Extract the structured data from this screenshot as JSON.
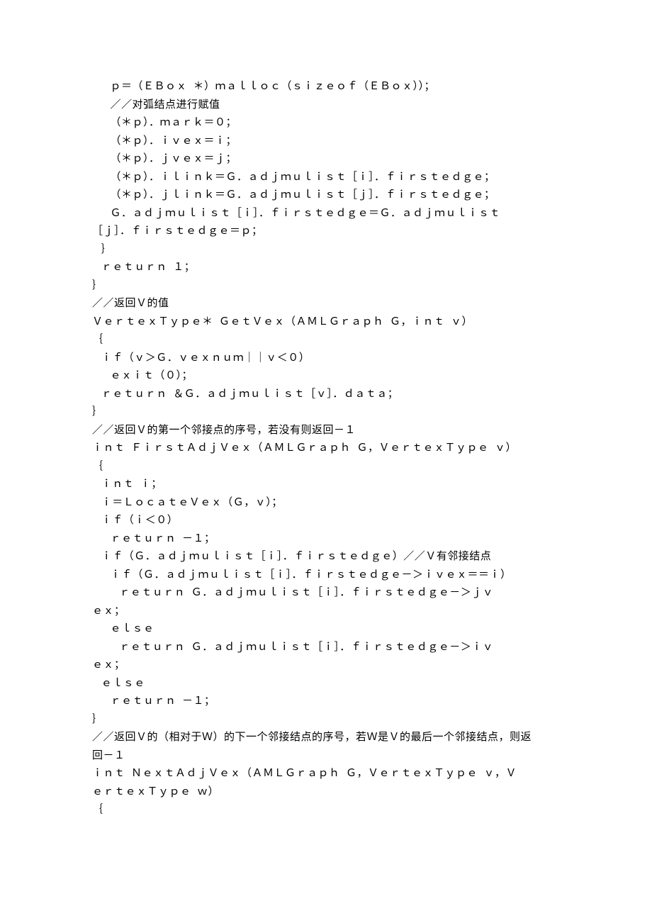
{
  "lines": [
    "      ｐ＝（ＥＢｏｘ  ＊）ｍａｌｌｏｃ（ｓｉｚｅｏｆ（ＥＢｏｘ））；",
    "      ／／对弧结点进行赋值",
    "      （＊ｐ）．ｍａｒｋ＝０；",
    "      （＊ｐ）．ｉｖｅｘ＝ｉ；",
    "      （＊ｐ）．ｊｖｅｘ＝ｊ；",
    "      （＊ｐ）．ｉｌｉｎｋ＝Ｇ．ａｄｊｍｕｌｉｓｔ［ｉ］．ｆｉｒｓｔｅｄｇｅ；",
    "      （＊ｐ）．ｊｌｉｎｋ＝Ｇ．ａｄｊｍｕｌｉｓｔ［ｊ］．ｆｉｒｓｔｅｄｇｅ；",
    "      Ｇ．ａｄｊｍｕｌｉｓｔ［ｉ］．ｆｉｒｓｔｅｄｇｅ＝Ｇ．ａｄｊｍｕｌｉｓｔ",
    "［ｊ］．ｆｉｒｓｔｅｄｇｅ＝ｐ；",
    "",
    "   ｝",
    "   ｒｅｔｕｒｎ  １；",
    "｝",
    "",
    "／／返回Ｖ的值",
    "ＶｅｒｔｅｘＴｙｐｅ＊  ＧｅｔＶｅｘ（ＡＭＬＧｒａｐｈ  Ｇ，ｉｎｔ  ｖ）",
    "｛",
    "   ｉｆ（ｖ＞Ｇ．ｖｅｘｎｕｍ｜｜ｖ＜０）",
    "      ｅｘｉｔ（０）；",
    "   ｒｅｔｕｒｎ  ＆Ｇ．ａｄｊｍｕｌｉｓｔ［ｖ］．ｄａｔａ；",
    "｝",
    "／／返回Ｖ的第一个邻接点的序号，若没有则返回－１",
    "ｉｎｔ  ＦｉｒｓｔＡｄｊＶｅｘ（ＡＭＬＧｒａｐｈ  Ｇ，ＶｅｒｔｅｘＴｙｐｅ  ｖ）",
    "｛",
    "",
    "   ｉｎｔ  ｉ；",
    "   ｉ＝ＬｏｃａｔｅＶｅｘ（Ｇ，ｖ）；",
    "   ｉｆ（ｉ＜０）",
    "      ｒｅｔｕｒｎ  －１；",
    "   ｉｆ（Ｇ．ａｄｊｍｕｌｉｓｔ［ｉ］．ｆｉｒｓｔｅｄｇｅ）／／Ｖ有邻接结点",
    "      ｉｆ（Ｇ．ａｄｊｍｕｌｉｓｔ［ｉ］．ｆｉｒｓｔｅｄｇｅ－＞ｉｖｅｘ＝＝ｉ）",
    "         ｒｅｔｕｒｎ  Ｇ．ａｄｊｍｕｌｉｓｔ［ｉ］．ｆｉｒｓｔｅｄｇｅ－＞ｊｖ",
    "ｅｘ；",
    "      ｅｌｓｅ",
    "         ｒｅｔｕｒｎ  Ｇ．ａｄｊｍｕｌｉｓｔ［ｉ］．ｆｉｒｓｔｅｄｇｅ－＞ｉｖ",
    "ｅｘ；",
    "   ｅｌｓｅ",
    "      ｒｅｔｕｒｎ  －１；",
    "｝",
    "／／返回Ｖ的（相对于Ｗ）的下一个邻接结点的序号，若Ｗ是Ｖ的最后一个邻接结点，则返",
    "回－１",
    "ｉｎｔ  ＮｅｘｔＡｄｊＶｅｘ（ＡＭＬＧｒａｐｈ  Ｇ，ＶｅｒｔｅｘＴｙｐｅ  ｖ，Ｖ",
    "ｅｒｔｅｘＴｙｐｅ  ｗ）",
    "｛"
  ]
}
